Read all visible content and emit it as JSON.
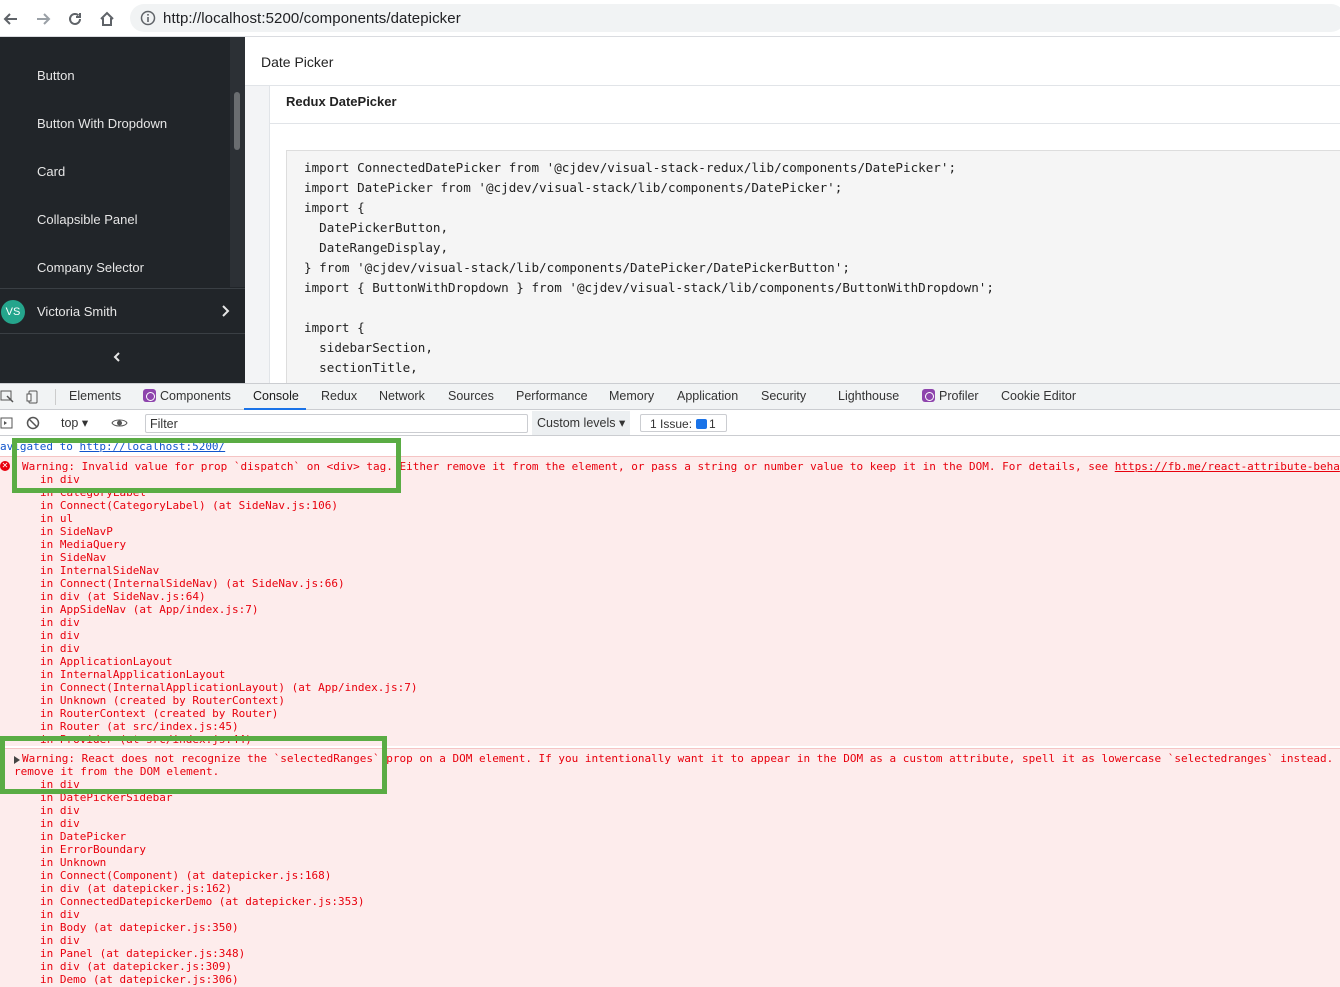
{
  "browser": {
    "url": "http://localhost:5200/components/datepicker",
    "icons": [
      "back-icon",
      "forward-icon",
      "reload-icon",
      "home-icon",
      "info-icon"
    ]
  },
  "sidebar": {
    "items": [
      {
        "label": "Button"
      },
      {
        "label": "Button With Dropdown"
      },
      {
        "label": "Card"
      },
      {
        "label": "Collapsible Panel"
      },
      {
        "label": "Company Selector"
      }
    ],
    "user": {
      "initials": "VS",
      "name": "Victoria Smith"
    }
  },
  "header": {
    "title": "Date Picker"
  },
  "panel": {
    "title": "Redux DatePicker",
    "code": [
      "import ConnectedDatePicker from '@cjdev/visual-stack-redux/lib/components/DatePicker';",
      "import DatePicker from '@cjdev/visual-stack/lib/components/DatePicker';",
      "import {",
      "  DatePickerButton,",
      "  DateRangeDisplay,",
      "} from '@cjdev/visual-stack/lib/components/DatePicker/DatePickerButton';",
      "import { ButtonWithDropdown } from '@cjdev/visual-stack/lib/components/ButtonWithDropdown';",
      "",
      "import {",
      "  sidebarSection,",
      "  sectionTitle,"
    ]
  },
  "devtools": {
    "tabs": [
      "Elements",
      "Components",
      "Console",
      "Redux",
      "Network",
      "Sources",
      "Performance",
      "Memory",
      "Application",
      "Security",
      "Lighthouse",
      "Profiler",
      "Cookie Editor"
    ],
    "active_tab": "Console",
    "context": "top",
    "filter_placeholder": "Filter",
    "levels": "Custom levels",
    "issues": "1 Issue:",
    "issues_count": "1"
  },
  "console": {
    "nav_text": "avigated to",
    "nav_url": "http://localhost:5200/",
    "error1": {
      "message": "Warning: Invalid value for prop `dispatch` on <div> tag. Either remove it from the element, or pass a string or number value to keep it in the DOM. For details, see ",
      "link": "https://fb.me/react-attribute-beha",
      "stack": [
        "in div",
        "in CategoryLabel",
        "in Connect(CategoryLabel) (at SideNav.js:106)",
        "in ul",
        "in SideNavP",
        "in MediaQuery",
        "in SideNav",
        "in InternalSideNav",
        "in Connect(InternalSideNav) (at SideNav.js:66)",
        "in div (at SideNav.js:64)",
        "in AppSideNav (at App/index.js:7)",
        "in div",
        "in div",
        "in div",
        "in ApplicationLayout",
        "in InternalApplicationLayout",
        "in Connect(InternalApplicationLayout) (at App/index.js:7)",
        "in Unknown (created by RouterContext)",
        "in RouterContext (created by Router)",
        "in Router (at src/index.js:45)",
        "in Provider (at src/index.js:44)"
      ]
    },
    "error2": {
      "line1": "Warning: React does not recognize the `selectedRanges` prop on a DOM element. If you intentionally want it to appear in the DOM as a custom attribute, spell it as lowercase `selectedranges` instead.",
      "line2": "remove it from the DOM element.",
      "stack": [
        "in div",
        "in DatePickerSidebar",
        "in div",
        "in div",
        "in DatePicker",
        "in ErrorBoundary",
        "in Unknown",
        "in Connect(Component) (at datepicker.js:168)",
        "in div (at datepicker.js:162)",
        "in ConnectedDatepickerDemo (at datepicker.js:353)",
        "in div",
        "in Body (at datepicker.js:350)",
        "in div",
        "in Panel (at datepicker.js:348)",
        "in div (at datepicker.js:309)",
        "in Demo (at datepicker.js:306)"
      ]
    }
  },
  "colors": {
    "sidebar_bg": "#212529",
    "error_text": "#e8000d",
    "error_bg": "#fdecec",
    "highlight": "#5aac44",
    "accent": "#1a73e8"
  }
}
